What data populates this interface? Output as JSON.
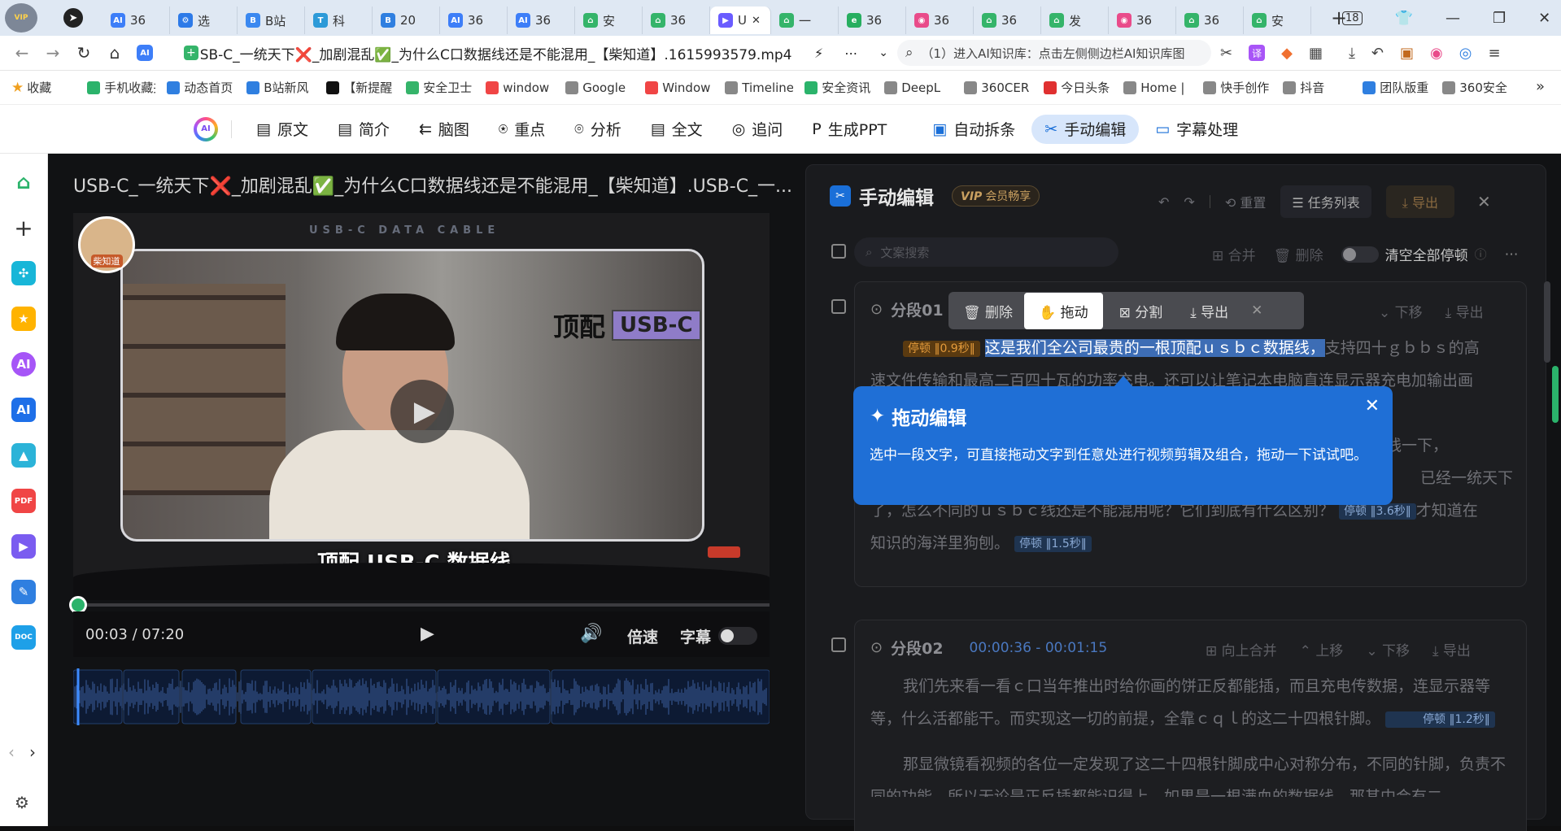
{
  "tabs": [
    {
      "label": "36",
      "color": "#3d7ef8",
      "glyph": "AI"
    },
    {
      "label": "选",
      "color": "#2d7ae8",
      "glyph": "⚙"
    },
    {
      "label": "B站",
      "color": "#3a88f0",
      "glyph": "B"
    },
    {
      "label": "科",
      "color": "#2d9ad8",
      "glyph": "T"
    },
    {
      "label": "20",
      "color": "#2f7fe0",
      "glyph": "B"
    },
    {
      "label": "36",
      "color": "#3d7ef8",
      "glyph": "AI"
    },
    {
      "label": "36",
      "color": "#3d7ef8",
      "glyph": "AI"
    },
    {
      "label": "安",
      "color": "#35b46a",
      "glyph": "⌂"
    },
    {
      "label": "36",
      "color": "#35b46a",
      "glyph": "⌂"
    },
    {
      "label": "U",
      "color": "#6a5cff",
      "glyph": "▶"
    },
    {
      "label": "一",
      "color": "#35b46a",
      "glyph": "⌂"
    },
    {
      "label": "36",
      "color": "#27ae60",
      "glyph": "e"
    },
    {
      "label": "36",
      "color": "#e94b8a",
      "glyph": "◉"
    },
    {
      "label": "36",
      "color": "#35b46a",
      "glyph": "⌂"
    },
    {
      "label": "发",
      "color": "#35b46a",
      "glyph": "⌂"
    },
    {
      "label": "36",
      "color": "#e94b8a",
      "glyph": "◉"
    },
    {
      "label": "36",
      "color": "#35b46a",
      "glyph": "⌂"
    },
    {
      "label": "安",
      "color": "#35b46a",
      "glyph": "⌂"
    }
  ],
  "tab_count": "18",
  "address": {
    "url": "SB-C_一统天下❌_加剧混乱✅_为什么C口数据线还是不能混用_【柴知道】.1615993579.mp4",
    "search": "（1）进入AI知识库：点击左侧侧边栏AI知识库图"
  },
  "bookmarks": [
    "收藏",
    "手机收藏夹",
    "动态首页",
    "B站新风",
    "【新提醒",
    "安全卫士",
    "window",
    "Google",
    "Window",
    "Timeline",
    "安全资讯",
    "DeepL",
    "360CER",
    "今日头条",
    "Home |",
    "快手创作",
    "抖音",
    "团队版重",
    "360安全"
  ],
  "toolbar": {
    "items": [
      "原文",
      "简介",
      "脑图",
      "重点",
      "分析",
      "全文",
      "追问",
      "生成PPT",
      "自动拆条",
      "手动编辑",
      "字幕处理"
    ]
  },
  "video": {
    "title": "USB-C_一统天下❌_加剧混乱✅_为什么C口数据线还是不能混用_【柴知道】.USB-C_一...",
    "banner": "USB-C DATA CABLE",
    "tag_a": "顶配",
    "tag_b": "USB-C",
    "caption": "顶配 USB-C 数据线",
    "time": "00:03 / 07:20",
    "speed": "倍速",
    "subtitle": "字幕",
    "logo": "柴知道",
    "progress_fraction": 0.007
  },
  "panel": {
    "title": "手动编辑",
    "vip": "会员畅享",
    "reset": "重置",
    "tasks": "任务列表",
    "export": "导出",
    "search_placeholder": "文案搜索",
    "merge": "合并",
    "delete": "删除",
    "clear_pauses": "清空全部停顿"
  },
  "context_menu": {
    "delete": "删除",
    "drag": "拖动",
    "split": "分割",
    "export": "导出"
  },
  "tooltip": {
    "title": "拖动编辑",
    "body": "选中一段文字，可直接拖动文字到任意处进行视频剪辑及组合，拖动一下试试吧。"
  },
  "segments": [
    {
      "label": "分段01",
      "time": "",
      "move_down": "下移",
      "export": "导出",
      "pause_first": "停顿",
      "pause_first_dur": "0.9秒",
      "selected": "这是我们全公司最贵的一根顶配ｕｓｂｃ数据线，",
      "line1_rest": "支持四十ｇｂｂｓ的高",
      "line2": "速文件传输和最高二百四十瓦的功率充电。还可以让笔记本电脑直连显示器充电加输出画",
      "line3_end": "线一下，",
      "line4_end": "已经一统天下",
      "line5": "了，怎么不同的ｕｓｂｃ线还是不能混用呢？它们到底有什么区别？",
      "pause2": "停顿",
      "pause2_dur": "3.6秒",
      "line5_tail": "才知道在",
      "line6": "知识的海洋里狗刨。",
      "pause3": "停顿",
      "pause3_dur": "1.5秒"
    },
    {
      "label": "分段02",
      "time": "00:00:36 - 00:01:15",
      "merge_up": "向上合并",
      "move_up": "上移",
      "move_down": "下移",
      "export": "导出",
      "para1": "我们先来看一看ｃ口当年推出时给你画的饼正反都能插，而且充电传数据，连显示器等等，什么活都能干。而实现这一切的前提，全靠ｃｑｌ的这二十四根针脚。",
      "pause": "停顿",
      "pause_dur": "1.2秒",
      "para2": "那显微镜看视频的各位一定发现了这二十四根针脚成中心对称分布，不同的针脚，负责不同的功能，所以无论是正反插都能识得上。如果是一根满血的数据线，那其中会有二"
    }
  ]
}
